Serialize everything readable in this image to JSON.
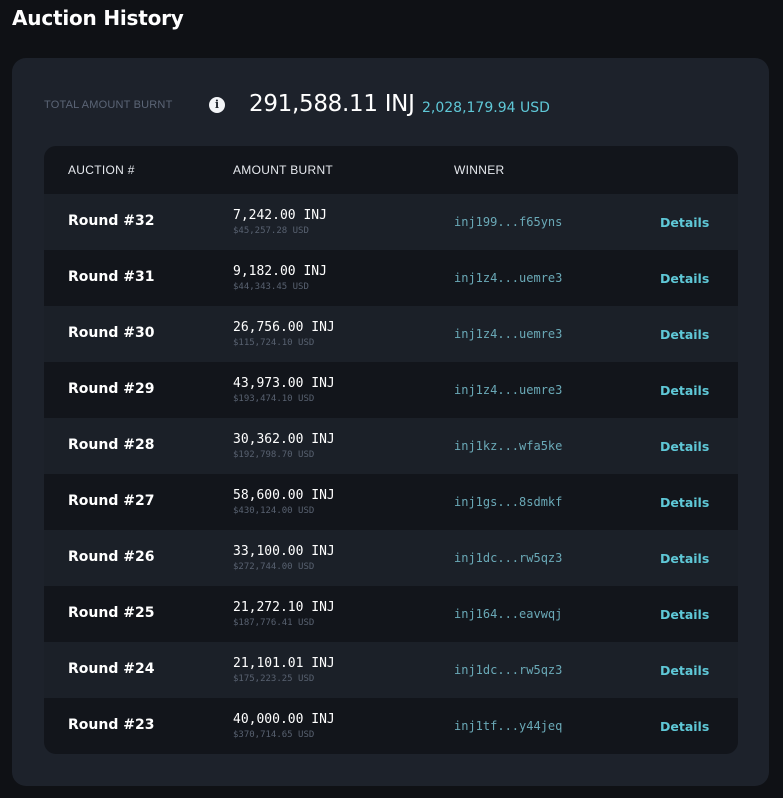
{
  "page": {
    "title": "Auction History"
  },
  "summary": {
    "label": "TOTAL AMOUNT BURNT",
    "info_icon": "i",
    "total_inj": "291,588.11 INJ",
    "total_usd": "2,028,179.94 USD"
  },
  "table": {
    "headers": [
      "AUCTION #",
      "AMOUNT BURNT",
      "WINNER"
    ],
    "details_label": "Details",
    "rows": [
      {
        "round": "Round #32",
        "amount": "7,242.00 INJ",
        "usd": "$45,257.28 USD",
        "winner": "inj199...f65yns"
      },
      {
        "round": "Round #31",
        "amount": "9,182.00 INJ",
        "usd": "$44,343.45 USD",
        "winner": "inj1z4...uemre3"
      },
      {
        "round": "Round #30",
        "amount": "26,756.00 INJ",
        "usd": "$115,724.10 USD",
        "winner": "inj1z4...uemre3"
      },
      {
        "round": "Round #29",
        "amount": "43,973.00 INJ",
        "usd": "$193,474.10 USD",
        "winner": "inj1z4...uemre3"
      },
      {
        "round": "Round #28",
        "amount": "30,362.00 INJ",
        "usd": "$192,798.70 USD",
        "winner": "inj1kz...wfa5ke"
      },
      {
        "round": "Round #27",
        "amount": "58,600.00 INJ",
        "usd": "$430,124.00 USD",
        "winner": "inj1gs...8sdmkf"
      },
      {
        "round": "Round #26",
        "amount": "33,100.00 INJ",
        "usd": "$272,744.00 USD",
        "winner": "inj1dc...rw5qz3"
      },
      {
        "round": "Round #25",
        "amount": "21,272.10 INJ",
        "usd": "$187,776.41 USD",
        "winner": "inj164...eavwqj"
      },
      {
        "round": "Round #24",
        "amount": "21,101.01 INJ",
        "usd": "$175,223.25 USD",
        "winner": "inj1dc...rw5qz3"
      },
      {
        "round": "Round #23",
        "amount": "40,000.00 INJ",
        "usd": "$370,714.65 USD",
        "winner": "inj1tf...y44jeq"
      }
    ]
  },
  "colors": {
    "background": "#0f1115",
    "panel": "#1d222b",
    "table": "#12151b",
    "row_alt": "#1b2028",
    "accent": "#5fc8d7"
  }
}
